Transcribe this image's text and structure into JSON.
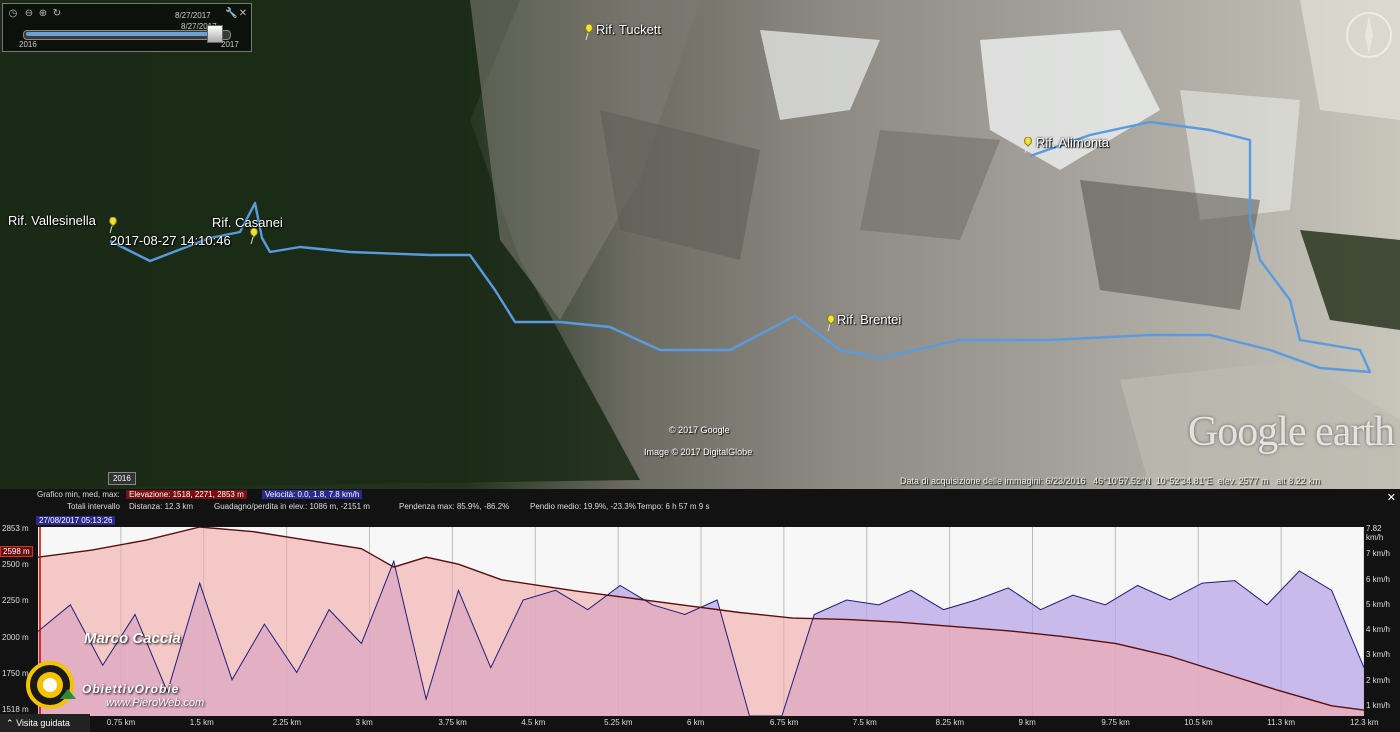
{
  "slider": {
    "date_start": "8/27/2017",
    "date_end": "8/27/2017",
    "year_left": "2016",
    "year_right": "2017",
    "fill_fraction": 0.96
  },
  "places": {
    "tuckett": "Rif. Tuckett",
    "alimonta": "Rif. Alimonta",
    "vallesinella": "Rif. Vallesinella",
    "casanei": "Rif. Casanei",
    "brentei": "Rif. Brentei",
    "timestamp": "2017-08-27 14:10:46"
  },
  "copyright": {
    "google": "© 2017 Google",
    "image": "Image © 2017 DigitalGlobe"
  },
  "logo_text": "Google earth",
  "badge": "2016",
  "status": {
    "date": "Data di acquisizione delle immagini: 6/23/2016",
    "lat": "46°10'57.52\"N",
    "lon": "10°52'34.81\"E",
    "elev": "elev. 2577 m",
    "alt": "alt 8.22 km"
  },
  "profile": {
    "graph_label": "Grafico min, med, max:",
    "elev": "Elevazione: 1518, 2271, 2853 m",
    "vel": "Velocità: 0.0, 1.8, 7.8 km/h",
    "totals": "Totali intervallo",
    "distance": "Distanza: 12.3 km",
    "gain": "Guadagno/perdita in elev.: 1086 m, -2151 m",
    "slope_max": "Pendenza max: 85.9%, -86.2%",
    "slope_avg": "Pendio medio: 19.9%, -23.3%",
    "time": "Tempo: 6 h 57 m 9 s",
    "date_tag": "27/08/2017 05:13:26",
    "current_elev": "2598 m",
    "y_left": [
      "2853 m",
      "2500 m",
      "2250 m",
      "2000 m",
      "1750 m",
      "1518 m"
    ],
    "y_right": [
      "7.82 km/h",
      "7 km/h",
      "6 km/h",
      "5 km/h",
      "4 km/h",
      "3 km/h",
      "2 km/h",
      "1 km/h"
    ],
    "x_labels": [
      "0.75 km",
      "1.5 km",
      "2.25 km",
      "3 km",
      "3.75 km",
      "4.5 km",
      "5.25 km",
      "6 km",
      "6.75 km",
      "7.5 km",
      "8.25 km",
      "9 km",
      "9.75 km",
      "10.5 km",
      "11.3 km",
      "12.3 km"
    ],
    "close": "✕"
  },
  "overlay": {
    "author": "Marco Caccia",
    "site": "ObiettivOrobie",
    "url": "www.PieroWeb.com"
  },
  "tour_button": "Visita guidata",
  "chart_data": {
    "type": "line",
    "xlabel": "",
    "ylabel": "",
    "xlim": [
      0,
      12.3
    ],
    "ylim": [
      1518,
      2853
    ],
    "series": [
      {
        "name": "Elevazione",
        "unit": "m",
        "x": [
          0,
          0.5,
          1.0,
          1.5,
          2.0,
          2.5,
          3.0,
          3.3,
          3.6,
          3.9,
          4.3,
          5.0,
          5.5,
          6.0,
          6.5,
          7.0,
          7.5,
          8.0,
          8.5,
          9.0,
          9.5,
          10.0,
          10.5,
          11.0,
          11.5,
          12.0,
          12.3
        ],
        "y": [
          2640,
          2690,
          2760,
          2853,
          2820,
          2760,
          2700,
          2570,
          2640,
          2590,
          2480,
          2400,
          2350,
          2300,
          2250,
          2210,
          2200,
          2180,
          2150,
          2120,
          2080,
          2030,
          1940,
          1820,
          1700,
          1590,
          1560
        ]
      },
      {
        "name": "Velocità",
        "unit": "km/h",
        "x": [
          0,
          0.3,
          0.6,
          0.9,
          1.2,
          1.5,
          1.8,
          2.1,
          2.4,
          2.7,
          3.0,
          3.3,
          3.6,
          3.9,
          4.2,
          4.5,
          4.8,
          5.1,
          5.4,
          5.7,
          6.0,
          6.3,
          6.6,
          6.9,
          7.2,
          7.5,
          7.8,
          8.1,
          8.4,
          8.7,
          9.0,
          9.3,
          9.6,
          9.9,
          10.2,
          10.5,
          10.8,
          11.1,
          11.4,
          11.7,
          12.0,
          12.3
        ],
        "y": [
          3.5,
          4.6,
          2.1,
          4.2,
          1.0,
          5.5,
          1.5,
          3.8,
          1.8,
          4.4,
          3.0,
          6.4,
          0.7,
          5.2,
          2.0,
          4.8,
          5.2,
          4.4,
          5.4,
          4.6,
          4.2,
          4.8,
          0.0,
          0.0,
          4.2,
          4.8,
          4.6,
          5.2,
          4.4,
          4.8,
          5.3,
          4.4,
          5.0,
          4.6,
          5.4,
          4.8,
          5.5,
          5.6,
          4.6,
          6.0,
          5.2,
          2.0
        ]
      }
    ]
  }
}
